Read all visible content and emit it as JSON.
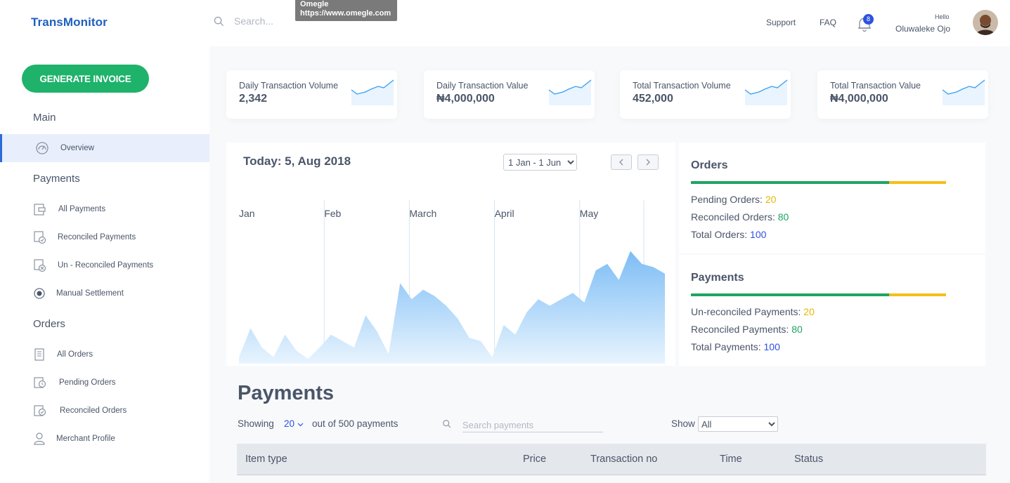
{
  "header": {
    "brand": "TransMonitor",
    "search_placeholder": "Search...",
    "tooltip_title": "Omegle",
    "tooltip_url": "https://www.omegle.com",
    "links": [
      "Support",
      "FAQ"
    ],
    "notification_count": "8",
    "greeting": "Hello",
    "user_name": "Oluwaleke Ojo"
  },
  "sidebar": {
    "generate_button": "GENERATE INVOICE",
    "sections": {
      "main": "Main",
      "payments": "Payments",
      "orders": "Orders"
    },
    "main_items": [
      {
        "label": "Overview",
        "icon": "dashboard-gauge-icon"
      }
    ],
    "payment_items": [
      {
        "label": "All Payments",
        "icon": "wallet-icon"
      },
      {
        "label": "Reconciled Payments",
        "icon": "wallet-check-icon"
      },
      {
        "label": "Un - Reconciled Payments",
        "icon": "wallet-x-icon"
      },
      {
        "label": "Manual Settlement",
        "icon": "radio-dot-icon"
      }
    ],
    "order_items": [
      {
        "label": "All Orders",
        "icon": "receipt-icon"
      },
      {
        "label": "Pending Orders",
        "icon": "receipt-clock-icon"
      },
      {
        "label": "Reconciled Orders",
        "icon": "receipt-check-icon"
      },
      {
        "label": "Merchant Profile",
        "icon": "user-icon"
      }
    ]
  },
  "stats": [
    {
      "label": "Daily Transaction Volume",
      "value": "2,342"
    },
    {
      "label": "Daily Transaction Value",
      "value": "₦4,000,000"
    },
    {
      "label": "Total Transaction Volume",
      "value": "452,000"
    },
    {
      "label": "Total Transaction Value",
      "value": "₦4,000,000"
    }
  ],
  "chart": {
    "today": "Today: 5, Aug 2018",
    "range": "1 Jan - 1 Jun",
    "months": [
      "Jan",
      "Feb",
      "March",
      "April",
      "May"
    ]
  },
  "chart_data": {
    "type": "area",
    "x": [
      "Jan",
      "Feb",
      "March",
      "April",
      "May"
    ],
    "series": [
      {
        "values": [
          4,
          22,
          10,
          4,
          18,
          8,
          3,
          10,
          18,
          14,
          10,
          30,
          20,
          6,
          50,
          40,
          46,
          42,
          36,
          28,
          16,
          14,
          4,
          24,
          18,
          32,
          40,
          36,
          40,
          44,
          38,
          58,
          62,
          52,
          70,
          62,
          60,
          56
        ]
      }
    ],
    "grid": false
  },
  "orders": {
    "title": "Orders",
    "pending_label": "Pending Orders:",
    "pending": "20",
    "reconciled_label": "Reconciled Orders:",
    "reconciled": "80",
    "total_label": "Total Orders:",
    "total": "100"
  },
  "payments_summary": {
    "title": "Payments",
    "unreconciled_label": "Un-reconciled Payments:",
    "unreconciled": "20",
    "reconciled_label": "Reconciled Payments:",
    "reconciled": "80",
    "total_label": "Total Payments:",
    "total": "100"
  },
  "payments_table": {
    "title": "Payments",
    "showing": "Showing",
    "page_size": "20",
    "out_of": "out of 500 payments",
    "search_placeholder": "Search payments",
    "show_label": "Show",
    "show_value": "All",
    "columns": [
      "Item type",
      "Price",
      "Transaction no",
      "Time",
      "Status"
    ]
  },
  "colors": {
    "brand": "#1f5fbf",
    "primary_green": "#1fb26a",
    "accent_blue": "#2d52e0",
    "warning_yellow": "#f5be1a",
    "chart_blue": "#7dbdf5"
  }
}
